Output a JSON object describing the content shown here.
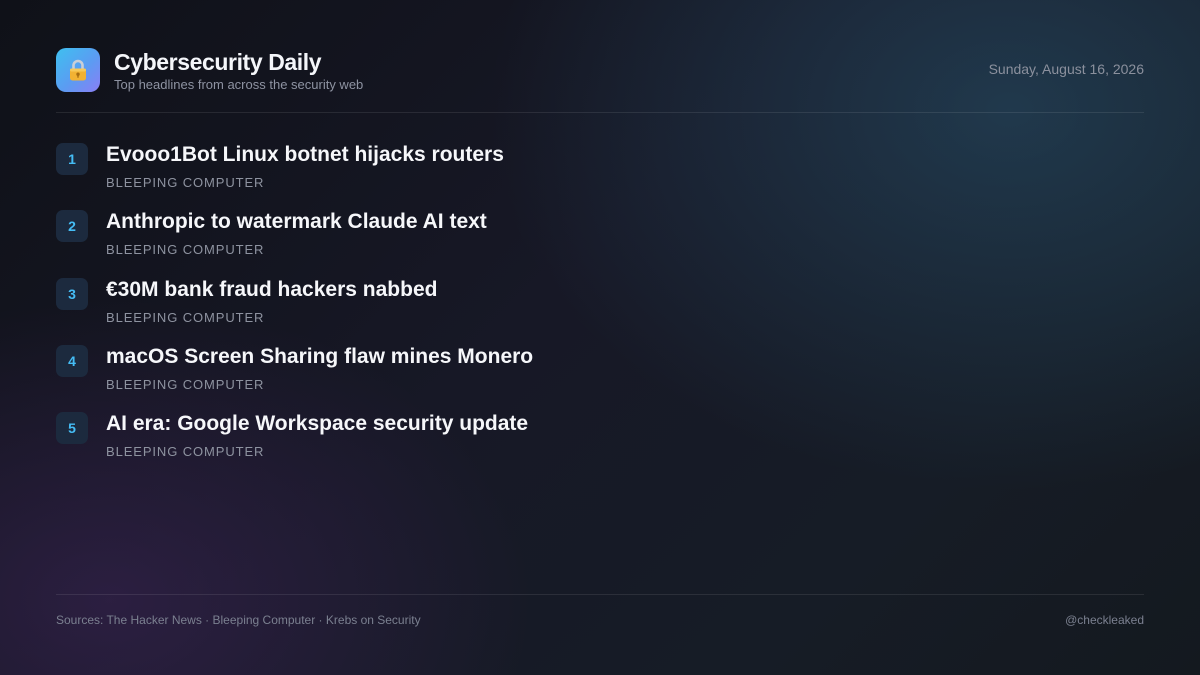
{
  "header": {
    "logo_icon": "lock-icon",
    "logo_gradient": [
      "#3ec0f0",
      "#8a7ef5"
    ],
    "title": "Cybersecurity Daily",
    "subtitle": "Top headlines from across the security web",
    "date": "Sunday, August 16, 2026"
  },
  "headlines": [
    {
      "rank": "1",
      "title": "Evooo1Bot Linux botnet hijacks routers",
      "source": "Bleeping Computer"
    },
    {
      "rank": "2",
      "title": "Anthropic to watermark Claude AI text",
      "source": "Bleeping Computer"
    },
    {
      "rank": "3",
      "title": "€30M bank fraud hackers nabbed",
      "source": "Bleeping Computer"
    },
    {
      "rank": "4",
      "title": "macOS Screen Sharing flaw mines Monero",
      "source": "Bleeping Computer"
    },
    {
      "rank": "5",
      "title": "AI era: Google Workspace security update",
      "source": "Bleeping Computer"
    }
  ],
  "footer": {
    "sources": "Sources: The Hacker News · Bleeping Computer · Krebs on Security",
    "handle": "@checkleaked"
  },
  "colors": {
    "accent": "#45bdf5",
    "badge_background": "#1c2a3e"
  }
}
